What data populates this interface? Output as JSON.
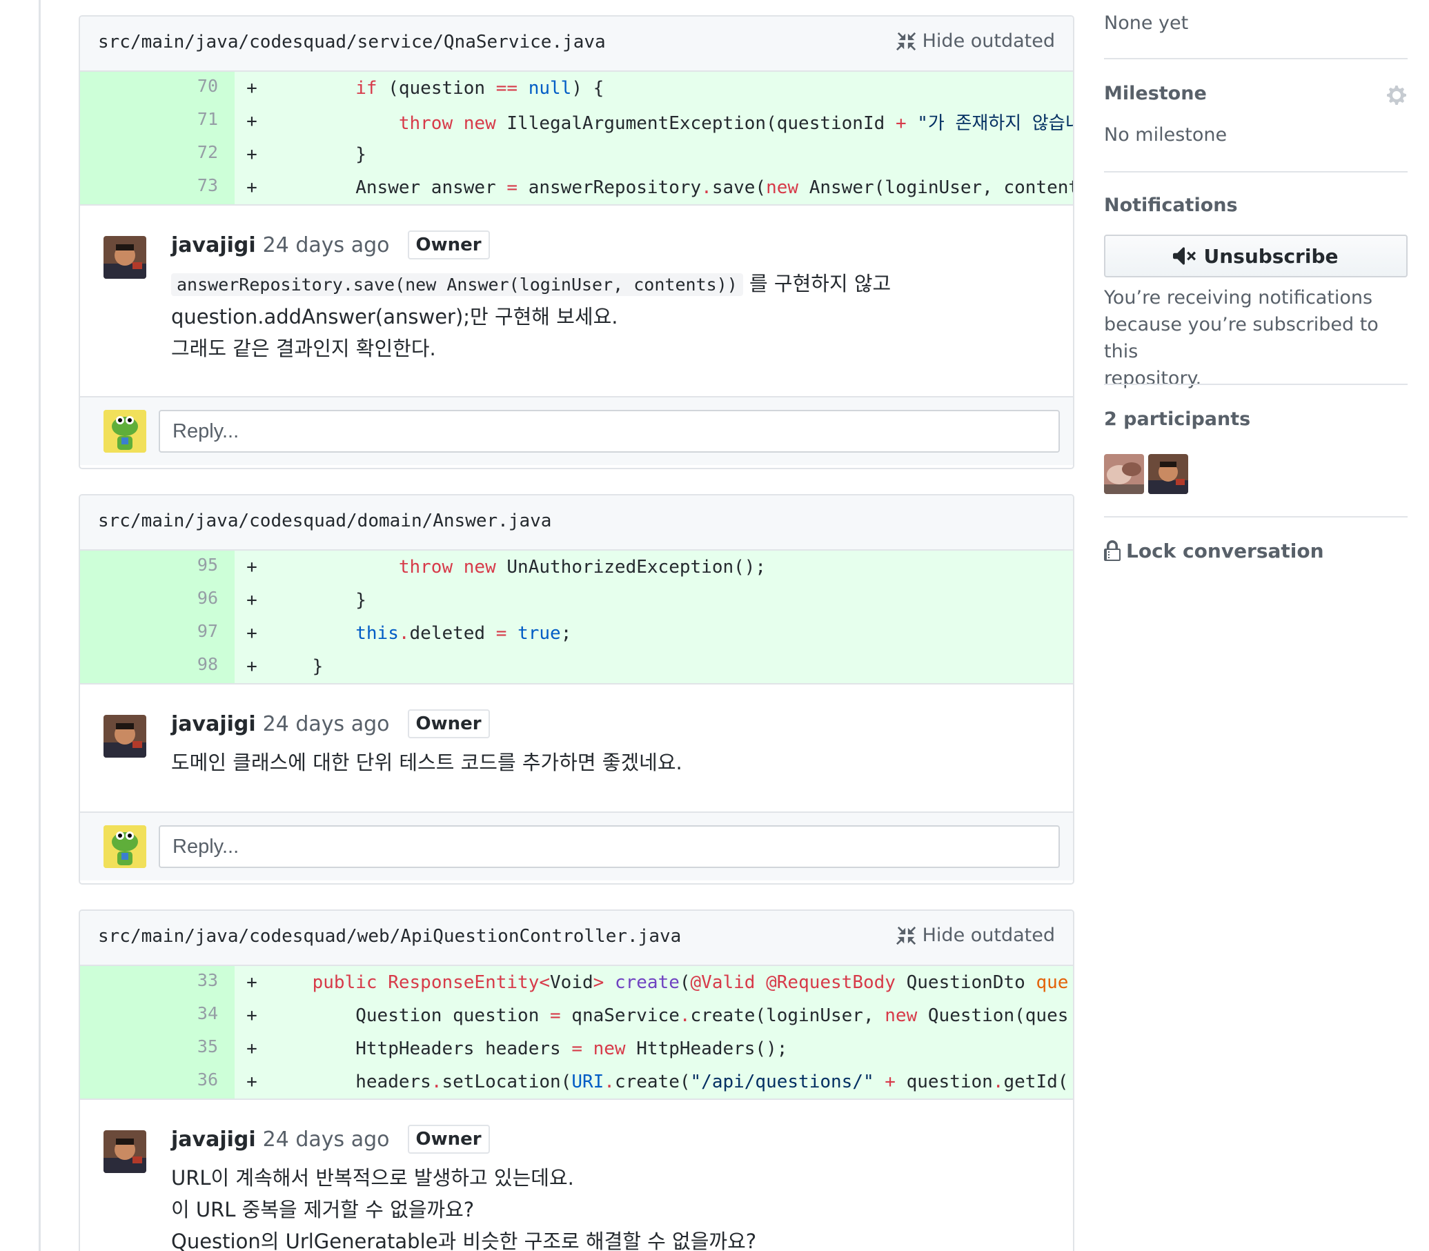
{
  "cards": [
    {
      "file": "src/main/java/codesquad/service/QnaService.java",
      "hide_outdated": "Hide outdated",
      "lines": [
        {
          "num": "70",
          "sign": "+"
        },
        {
          "num": "71",
          "sign": "+"
        },
        {
          "num": "72",
          "sign": "+"
        },
        {
          "num": "73",
          "sign": "+"
        }
      ],
      "comment": {
        "author": "javajigi",
        "time": "24 days ago",
        "badge": "Owner",
        "code": "answerRepository.save(new Answer(loginUser, contents))",
        "line1_rest": " 를 구현하지 않고",
        "line2": "question.addAnswer(answer);만 구현해 보세요.",
        "line3": "그래도 같은 결과인지 확인한다."
      },
      "reply_placeholder": "Reply..."
    },
    {
      "file": "src/main/java/codesquad/domain/Answer.java",
      "lines": [
        {
          "num": "95",
          "sign": "+"
        },
        {
          "num": "96",
          "sign": "+"
        },
        {
          "num": "97",
          "sign": "+"
        },
        {
          "num": "98",
          "sign": "+"
        }
      ],
      "comment": {
        "author": "javajigi",
        "time": "24 days ago",
        "badge": "Owner",
        "line1": "도메인 클래스에 대한 단위 테스트 코드를 추가하면 좋겠네요."
      },
      "reply_placeholder": "Reply..."
    },
    {
      "file": "src/main/java/codesquad/web/ApiQuestionController.java",
      "hide_outdated": "Hide outdated",
      "lines": [
        {
          "num": "33",
          "sign": "+"
        },
        {
          "num": "34",
          "sign": "+"
        },
        {
          "num": "35",
          "sign": "+"
        },
        {
          "num": "36",
          "sign": "+"
        }
      ],
      "comment": {
        "author": "javajigi",
        "time": "24 days ago",
        "badge": "Owner",
        "line1": "URL이 계속해서 반복적으로 발생하고 있는데요.",
        "line2": "이 URL 중복을 제거할 수 없을까요?",
        "line3": "Question의 UrlGeneratable과 비슷한 구조로 해결할 수 없을까요?"
      }
    }
  ],
  "code": {
    "c1": {
      "l70": [
        "if",
        " (question ",
        "==",
        " ",
        "null",
        ") {"
      ],
      "l71": [
        "throw",
        " ",
        "new",
        " IllegalArgumentException(questionId ",
        "+",
        " ",
        "\"가 존재하지 않습니"
      ],
      "l72": [
        "}"
      ],
      "l73": [
        "Answer answer ",
        "=",
        " answerRepository",
        ".",
        "save(",
        "new",
        " Answer(loginUser, content"
      ]
    },
    "c2": {
      "l95": [
        "throw",
        " ",
        "new",
        " UnAuthorizedException();"
      ],
      "l96": [
        "}"
      ],
      "l97": [
        "this",
        ".",
        "deleted ",
        "=",
        " ",
        "true",
        ";"
      ],
      "l98": [
        "}"
      ]
    },
    "c3": {
      "l33": [
        "public",
        " ",
        "ResponseEntity",
        "<",
        "Void",
        ">",
        " ",
        "create",
        "(",
        "@Valid",
        " ",
        "@RequestBody",
        " QuestionDto ",
        "que"
      ],
      "l34": [
        "Question question ",
        "=",
        " qnaService",
        ".",
        "create(loginUser, ",
        "new",
        " Question(ques"
      ],
      "l35": [
        "HttpHeaders headers ",
        "=",
        " ",
        "new",
        " HttpHeaders();"
      ],
      "l36": [
        "headers",
        ".",
        "setLocation(",
        "URI",
        ".",
        "create(",
        "\"/api/questions/\"",
        " ",
        "+",
        " question",
        ".",
        "getId("
      ]
    }
  },
  "sidebar": {
    "none_yet": "None yet",
    "milestone_title": "Milestone",
    "milestone_value": "No milestone",
    "notifications_title": "Notifications",
    "unsubscribe_label": "Unsubscribe",
    "notif_line1": "You’re receiving notifications",
    "notif_line2": "because you’re subscribed to this",
    "notif_line3": "repository.",
    "participants_title": "2 participants",
    "lock_label": "Lock conversation"
  },
  "colors": {
    "diff_bg": "#e6ffed",
    "diff_num_bg": "#cdffd8",
    "keyword": "#d73a49",
    "constant": "#005cc5"
  }
}
